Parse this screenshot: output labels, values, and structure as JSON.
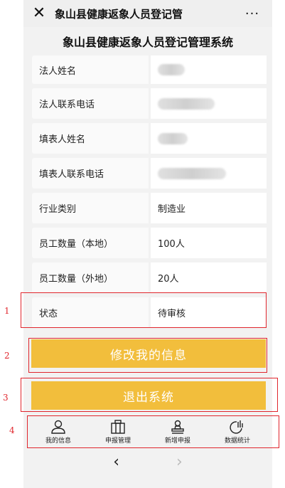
{
  "titlebar": {
    "close_glyph": "✕",
    "title": "象山县健康返象人员登记管",
    "more_glyph": "···"
  },
  "page": {
    "heading": "象山县健康返象人员登记管理系统"
  },
  "fields": [
    {
      "label": "法人姓名",
      "value": ""
    },
    {
      "label": "法人联系电话",
      "value": ""
    },
    {
      "label": "填表人姓名",
      "value": ""
    },
    {
      "label": "填表人联系电话",
      "value": ""
    },
    {
      "label": "行业类别",
      "value": "制造业"
    },
    {
      "label": "员工数量（本地）",
      "value": "100人"
    },
    {
      "label": "员工数量（外地）",
      "value": "20人"
    },
    {
      "label": "状态",
      "value": "待审核"
    }
  ],
  "buttons": {
    "edit": "修改我的信息",
    "logout": "退出系统"
  },
  "tabs": [
    {
      "label": "我的信息",
      "icon": "user-icon"
    },
    {
      "label": "申报管理",
      "icon": "briefcase-icon"
    },
    {
      "label": "新增申报",
      "icon": "stamp-icon"
    },
    {
      "label": "数据统计",
      "icon": "chart-icon"
    }
  ],
  "nav": {
    "back": "‹",
    "forward": "›"
  },
  "annotations": [
    "1",
    "2",
    "3",
    "4"
  ],
  "colors": {
    "accent": "#f2be3c",
    "annotation": "#e0262d"
  }
}
